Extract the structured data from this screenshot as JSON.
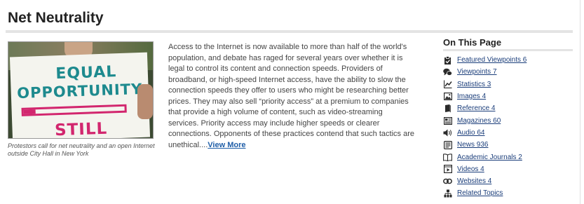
{
  "page": {
    "title": "Net Neutrality"
  },
  "image": {
    "sign_text": [
      "EQUAL",
      "OPPORTUNITY",
      "STILL LOADING"
    ],
    "caption": "Protestors call for net neutrality and an open Internet outside City Hall in New York",
    "colors": {
      "teal": "#1d8a8e",
      "magenta": "#d2266e"
    }
  },
  "summary": {
    "text": "Access to the Internet is now available to more than half of the world's population, and debate has raged for several years over whether it is legal to control its content and connection speeds. Providers of broadband, or high-speed Internet access, have the ability to slow the connection speeds they offer to users who might be researching better prices. They may also sell “priority access” at a premium to companies that provide a high volume of content, such as video-streaming services. Priority access may include higher speeds or clearer connections. Opponents of these practices contend that such tactics are unethical....",
    "view_more": "View More"
  },
  "on_this_page": {
    "title": "On This Page",
    "items": [
      {
        "icon": "clipboard-check-icon",
        "label": "Featured Viewpoints 6"
      },
      {
        "icon": "speech-bubbles-icon",
        "label": "Viewpoints 7"
      },
      {
        "icon": "bar-chart-icon",
        "label": "Statistics 3"
      },
      {
        "icon": "image-icon",
        "label": "Images 4"
      },
      {
        "icon": "book-icon",
        "label": "Reference 4"
      },
      {
        "icon": "magazine-icon",
        "label": "Magazines 60"
      },
      {
        "icon": "speaker-icon",
        "label": "Audio 64"
      },
      {
        "icon": "newspaper-icon",
        "label": "News 936"
      },
      {
        "icon": "open-book-icon",
        "label": "Academic Journals 2"
      },
      {
        "icon": "video-icon",
        "label": "Videos 4"
      },
      {
        "icon": "link-icon",
        "label": "Websites 4"
      },
      {
        "icon": "topics-icon",
        "label": "Related Topics"
      }
    ]
  }
}
